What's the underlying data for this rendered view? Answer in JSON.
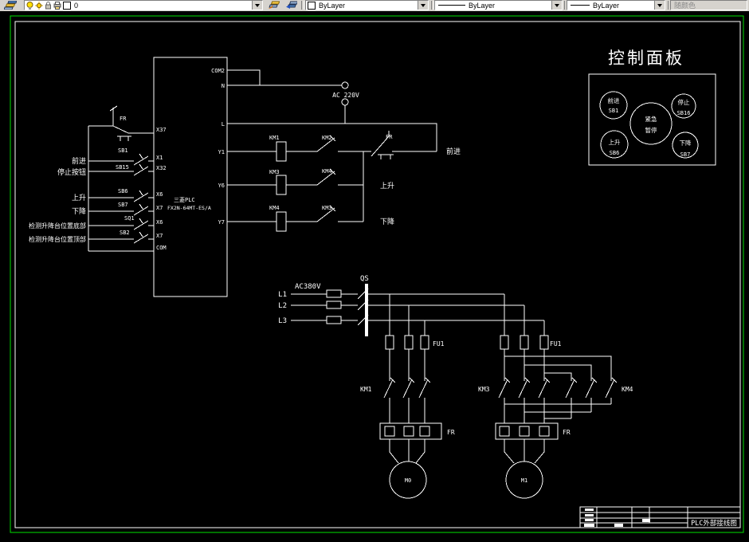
{
  "toolbar": {
    "layer_value": "0",
    "color_value": "ByLayer",
    "linetype_value": "ByLayer",
    "lineweight_value": "ByLayer",
    "plotstyle_value": "随颜色"
  },
  "control_panel": {
    "title": "控制面板",
    "btn_forward": {
      "line1": "前进",
      "line2": "SB1"
    },
    "btn_stop": {
      "line1": "停止",
      "line2": "SB16"
    },
    "btn_emergency": {
      "line1": "紧急",
      "line2": "暂停"
    },
    "btn_up": {
      "line1": "上升",
      "line2": "SB6"
    },
    "btn_down": {
      "line1": "下降",
      "line2": "SB7"
    }
  },
  "plc": {
    "name1": "三菱PLC",
    "name2": "FX2N-64MT-ES/A",
    "pins_left": [
      "X37",
      "X1",
      "X32",
      "X6",
      "X7",
      "X6",
      "X7",
      "COM"
    ],
    "pins_right": [
      "COM2",
      "N",
      "L",
      "Y1",
      "Y6",
      "Y7"
    ]
  },
  "inputs": {
    "row_labels": [
      "前进",
      "停止按钮",
      "上升",
      "下降",
      "检测升降台位置底部",
      "检测升降台位置顶部"
    ],
    "devices": {
      "fr": "FR",
      "sb1": "SB1",
      "sb15": "SB15",
      "sb6": "SB6",
      "sb7": "SB7",
      "sq1": "SQ1",
      "sb2": "SB2"
    }
  },
  "outputs": {
    "ac_label": "AC 220V",
    "rows": [
      {
        "coil": "KM1",
        "interlock": "KM2",
        "thermal": "FR",
        "label": "前进"
      },
      {
        "coil": "KM3",
        "interlock": "KM4",
        "label": "上升"
      },
      {
        "coil": "KM4",
        "interlock": "KM3",
        "label": "下降"
      }
    ]
  },
  "power": {
    "supply": "AC380V",
    "phases": [
      "L1",
      "L2",
      "L3"
    ],
    "qs": "QS",
    "fu1": "FU1",
    "km1": "KM1",
    "km3": "KM3",
    "km4": "KM4",
    "fr": "FR",
    "m0": "M0",
    "m1": "M1"
  },
  "title_block": {
    "name": "PLC外部接线图"
  }
}
